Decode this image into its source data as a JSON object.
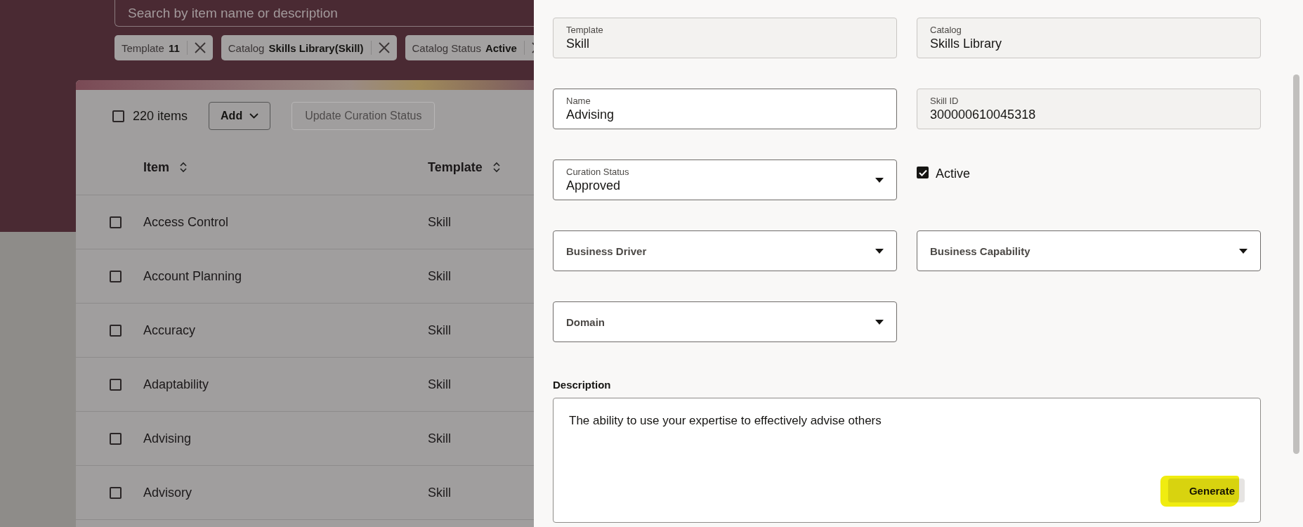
{
  "search": {
    "placeholder": "Search by item name or description"
  },
  "filter_chips": [
    {
      "label": "Template",
      "value": "11"
    },
    {
      "label": "Catalog",
      "value": "Skills Library(Skill)"
    },
    {
      "label": "Catalog Status",
      "value": "Active"
    }
  ],
  "toolbar": {
    "select_all_checked": false,
    "count": "220 items",
    "add_button": "Add",
    "update_button": {
      "label": "Update Curation Status",
      "disabled": true
    }
  },
  "table": {
    "columns": [
      "Item",
      "Template"
    ],
    "rows": [
      {
        "item": "Access Control",
        "template": "Skill",
        "checked": false
      },
      {
        "item": "Account Planning",
        "template": "Skill",
        "checked": false
      },
      {
        "item": "Accuracy",
        "template": "Skill",
        "checked": false
      },
      {
        "item": "Adaptability",
        "template": "Skill",
        "checked": false
      },
      {
        "item": "Advising",
        "template": "Skill",
        "checked": false
      },
      {
        "item": "Advisory",
        "template": "Skill",
        "checked": false
      }
    ]
  },
  "form": {
    "fields": [
      {
        "kind": "readonly",
        "label": "Template",
        "value": "Skill"
      },
      {
        "kind": "readonly",
        "label": "Catalog",
        "value": "Skills Library"
      },
      {
        "kind": "text",
        "label": "Name",
        "value": "Advising"
      },
      {
        "kind": "readonly",
        "label": "Skill ID",
        "value": "300000610045318"
      },
      {
        "kind": "select",
        "label": "Curation Status",
        "value": "Approved"
      },
      {
        "kind": "checkbox",
        "label": "Active",
        "checked": true
      },
      {
        "kind": "select",
        "label": "Business Driver"
      },
      {
        "kind": "select",
        "label": "Business Capability"
      },
      {
        "kind": "select",
        "label": "Domain"
      }
    ],
    "description": {
      "label": "Description",
      "value": "The ability to use your expertise to effectively advise others",
      "generate_button": "Generate"
    }
  }
}
